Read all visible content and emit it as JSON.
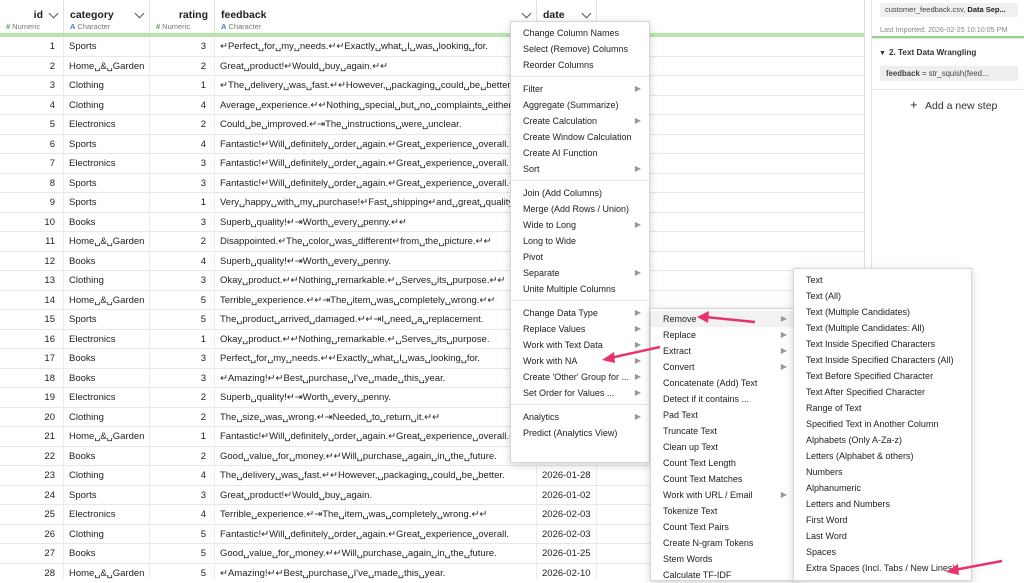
{
  "columns": [
    {
      "name": "id",
      "type_label": "Numeric",
      "type_icon": "#"
    },
    {
      "name": "category",
      "type_label": "Character",
      "type_icon": "A"
    },
    {
      "name": "rating",
      "type_label": "Numeric",
      "type_icon": "#"
    },
    {
      "name": "feedback",
      "type_label": "Character",
      "type_icon": "A"
    },
    {
      "name": "date",
      "type_label": "",
      "type_icon": ""
    }
  ],
  "rows": [
    {
      "id": "1",
      "category": "Sports",
      "rating": "3",
      "feedback": "↵Perfect␣for␣my␣needs.↵↵Exactly␣what␣I␣was␣looking␣for.",
      "date": ""
    },
    {
      "id": "2",
      "category": "Home␣&␣Garden",
      "rating": "2",
      "feedback": "Great␣product!↵Would␣buy␣again.↵↵",
      "date": ""
    },
    {
      "id": "3",
      "category": "Clothing",
      "rating": "1",
      "feedback": "↵The␣delivery␣was␣fast.↵↵However,␣packaging␣could␣be␣better.",
      "date": ""
    },
    {
      "id": "4",
      "category": "Clothing",
      "rating": "4",
      "feedback": "Average␣experience.↵↵Nothing␣special␣but␣no␣complaints␣either.",
      "date": ""
    },
    {
      "id": "5",
      "category": "Electronics",
      "rating": "2",
      "feedback": "Could␣be␣improved.↵⇥The␣instructions␣were␣unclear.",
      "date": ""
    },
    {
      "id": "6",
      "category": "Sports",
      "rating": "4",
      "feedback": "Fantastic!↵Will␣definitely␣order␣again.↵Great␣experience␣overall.",
      "date": ""
    },
    {
      "id": "7",
      "category": "Electronics",
      "rating": "3",
      "feedback": "Fantastic!↵Will␣definitely␣order␣again.↵Great␣experience␣overall.",
      "date": ""
    },
    {
      "id": "8",
      "category": "Sports",
      "rating": "3",
      "feedback": "Fantastic!↵Will␣definitely␣order␣again.↵Great␣experience␣overall.↵",
      "date": ""
    },
    {
      "id": "9",
      "category": "Sports",
      "rating": "1",
      "feedback": "Very␣happy␣with␣my␣purchase!↵Fast␣shipping↵and␣great␣quality.",
      "date": ""
    },
    {
      "id": "10",
      "category": "Books",
      "rating": "3",
      "feedback": "Superb␣quality!↵⇥Worth␣every␣penny.↵↵",
      "date": ""
    },
    {
      "id": "11",
      "category": "Home␣&␣Garden",
      "rating": "2",
      "feedback": "Disappointed.↵The␣color␣was␣different↵from␣the␣picture.↵↵",
      "date": ""
    },
    {
      "id": "12",
      "category": "Books",
      "rating": "4",
      "feedback": "Superb␣quality!↵⇥Worth␣every␣penny.",
      "date": ""
    },
    {
      "id": "13",
      "category": "Clothing",
      "rating": "3",
      "feedback": "Okay␣product.↵↵Nothing␣remarkable.↵␣Serves␣its␣purpose.↵↵",
      "date": ""
    },
    {
      "id": "14",
      "category": "Home␣&␣Garden",
      "rating": "5",
      "feedback": "Terrible␣experience.↵↵⇥The␣item␣was␣completely␣wrong.↵↵",
      "date": ""
    },
    {
      "id": "15",
      "category": "Sports",
      "rating": "5",
      "feedback": "The␣product␣arrived␣damaged.↵↵⇥I␣need␣a␣replacement.",
      "date": ""
    },
    {
      "id": "16",
      "category": "Electronics",
      "rating": "1",
      "feedback": "Okay␣product.↵↵Nothing␣remarkable.↵␣Serves␣its␣purpose.",
      "date": ""
    },
    {
      "id": "17",
      "category": "Books",
      "rating": "3",
      "feedback": "Perfect␣for␣my␣needs.↵↵Exactly␣what␣I␣was␣looking␣for.",
      "date": ""
    },
    {
      "id": "18",
      "category": "Books",
      "rating": "3",
      "feedback": "↵Amazing!↵↵Best␣purchase␣I've␣made␣this␣year.",
      "date": ""
    },
    {
      "id": "19",
      "category": "Electronics",
      "rating": "2",
      "feedback": "Superb␣quality!↵⇥Worth␣every␣penny.",
      "date": ""
    },
    {
      "id": "20",
      "category": "Clothing",
      "rating": "2",
      "feedback": "The␣size␣was␣wrong.↵⇥Needed␣to␣return␣it.↵↵",
      "date": ""
    },
    {
      "id": "21",
      "category": "Home␣&␣Garden",
      "rating": "1",
      "feedback": "Fantastic!↵Will␣definitely␣order␣again.↵Great␣experience␣overall.↵",
      "date": ""
    },
    {
      "id": "22",
      "category": "Books",
      "rating": "2",
      "feedback": "Good␣value␣for␣money.↵↵Will␣purchase␣again␣in␣the␣future.",
      "date": ""
    },
    {
      "id": "23",
      "category": "Clothing",
      "rating": "4",
      "feedback": "The␣delivery␣was␣fast.↵↵However,␣packaging␣could␣be␣better.",
      "date": "2026-01-28"
    },
    {
      "id": "24",
      "category": "Sports",
      "rating": "3",
      "feedback": "Great␣product!↵Would␣buy␣again.",
      "date": "2026-01-02"
    },
    {
      "id": "25",
      "category": "Electronics",
      "rating": "4",
      "feedback": "Terrible␣experience.↵⇥The␣item␣was␣completely␣wrong.↵↵",
      "date": "2026-02-03"
    },
    {
      "id": "26",
      "category": "Clothing",
      "rating": "5",
      "feedback": "Fantastic!↵Will␣definitely␣order␣again.↵Great␣experience␣overall.",
      "date": "2026-02-03"
    },
    {
      "id": "27",
      "category": "Books",
      "rating": "5",
      "feedback": "Good␣value␣for␣money.↵↵Will␣purchase␣again␣in␣the␣future.",
      "date": "2026-01-25"
    },
    {
      "id": "28",
      "category": "Home␣&␣Garden",
      "rating": "5",
      "feedback": "↵Amazing!↵↵Best␣purchase␣I've␣made␣this␣year.",
      "date": "2026-02-10"
    }
  ],
  "sidebar": {
    "source_file": "customer_feedback.csv,",
    "source_sep": "Data Sep...",
    "last_imported": "Last Imported: 2026-02-25 10:10:05 PM",
    "step_title": "2. Text Data Wrangling",
    "step_code_col": "feedback",
    "step_code_rest": " = str_squish(feed...",
    "add_step": "Add a new step"
  },
  "menu1": [
    {
      "label": "Change Column Names",
      "sub": false
    },
    {
      "label": "Select (Remove) Columns",
      "sub": false
    },
    {
      "label": "Reorder Columns",
      "sub": false
    },
    {
      "sep": true
    },
    {
      "label": "Filter",
      "sub": true
    },
    {
      "label": "Aggregate (Summarize)",
      "sub": false
    },
    {
      "label": "Create Calculation",
      "sub": true
    },
    {
      "label": "Create Window Calculation",
      "sub": false
    },
    {
      "label": "Create AI Function",
      "sub": false
    },
    {
      "label": "Sort",
      "sub": true
    },
    {
      "sep": true
    },
    {
      "label": "Join (Add Columns)",
      "sub": false
    },
    {
      "label": "Merge (Add Rows / Union)",
      "sub": false
    },
    {
      "label": "Wide to Long",
      "sub": true
    },
    {
      "label": "Long to Wide",
      "sub": false
    },
    {
      "label": "Pivot",
      "sub": false
    },
    {
      "label": "Separate",
      "sub": true
    },
    {
      "label": "Unite Multiple Columns",
      "sub": false
    },
    {
      "sep": true
    },
    {
      "label": "Change Data Type",
      "sub": true
    },
    {
      "label": "Replace Values",
      "sub": true
    },
    {
      "label": "Work with Text Data",
      "sub": true
    },
    {
      "label": "Work with NA",
      "sub": true
    },
    {
      "label": "Create 'Other' Group for ...",
      "sub": true
    },
    {
      "label": "Set Order for Values ...",
      "sub": true
    },
    {
      "sep": true
    },
    {
      "label": "Analytics",
      "sub": true
    },
    {
      "label": "Predict (Analytics View)",
      "sub": false
    }
  ],
  "menu2": [
    {
      "label": "Remove",
      "sub": true,
      "hl": true
    },
    {
      "label": "Replace",
      "sub": true
    },
    {
      "label": "Extract",
      "sub": true
    },
    {
      "label": "Convert",
      "sub": true
    },
    {
      "label": "Concatenate (Add) Text",
      "sub": false
    },
    {
      "label": "Detect if it contains ...",
      "sub": false
    },
    {
      "label": "Pad Text",
      "sub": false
    },
    {
      "label": "Truncate Text",
      "sub": false
    },
    {
      "label": "Clean up Text",
      "sub": false
    },
    {
      "label": "Count Text Length",
      "sub": false
    },
    {
      "label": "Count Text Matches",
      "sub": false
    },
    {
      "label": "Work with URL / Email",
      "sub": true
    },
    {
      "label": "Tokenize Text",
      "sub": false
    },
    {
      "label": "Count Text Pairs",
      "sub": false
    },
    {
      "label": "Create N-gram Tokens",
      "sub": false
    },
    {
      "label": "Stem Words",
      "sub": false
    },
    {
      "label": "Calculate TF-IDF",
      "sub": false
    }
  ],
  "menu3": [
    "Text",
    "Text (All)",
    "Text (Multiple Candidates)",
    "Text (Multiple Candidates: All)",
    "Text Inside Specified Characters",
    "Text Inside Specified Characters (All)",
    "Text Before Specified Character",
    "Text After Specified Character",
    "Range of Text",
    "Specified Text in Another Column",
    "Alphabets (Only A-Za-z)",
    "Letters (Alphabet & others)",
    "Numbers",
    "Alphanumeric",
    "Letters and Numbers",
    "First Word",
    "Last Word",
    "Spaces",
    "Extra Spaces (Incl. Tabs / New Lines)"
  ],
  "colors": {
    "accent": "#e8336b",
    "header_bar": "#b6e6ad"
  }
}
